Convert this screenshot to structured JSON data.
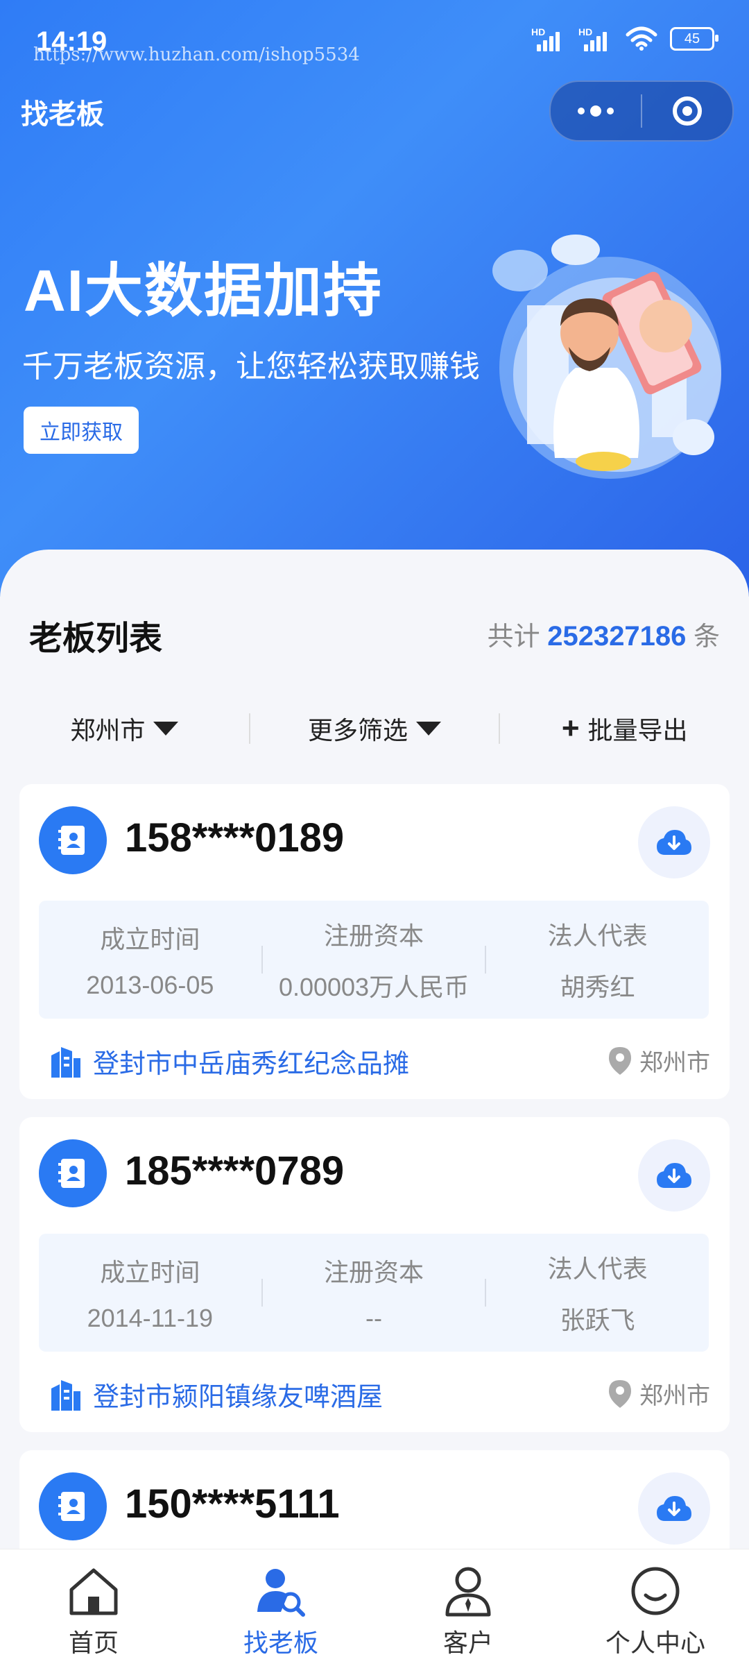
{
  "status": {
    "time": "14:19",
    "watermark": "https://www.huzhan.com/ishop5534",
    "hd1": "HD",
    "hd2": "HD",
    "battery": "45"
  },
  "header": {
    "title": "找老板"
  },
  "banner": {
    "title": "AI大数据加持",
    "subtitle": "千万老板资源，让您轻松获取赚钱",
    "button": "立即获取"
  },
  "list": {
    "title": "老板列表",
    "total_prefix": "共计",
    "total_count": "252327186",
    "total_suffix": "条"
  },
  "filters": {
    "city": "郑州市",
    "more": "更多筛选",
    "export": "批量导出"
  },
  "cards": [
    {
      "phone": "158****0189",
      "founded_label": "成立时间",
      "founded": "2013-06-05",
      "capital_label": "注册资本",
      "capital": "0.00003万人民币",
      "legal_label": "法人代表",
      "legal": "胡秀红",
      "company": "登封市中岳庙秀红纪念品摊",
      "city": "郑州市"
    },
    {
      "phone": "185****0789",
      "founded_label": "成立时间",
      "founded": "2014-11-19",
      "capital_label": "注册资本",
      "capital": "--",
      "legal_label": "法人代表",
      "legal": "张跃飞",
      "company": "登封市颍阳镇缘友啤酒屋",
      "city": "郑州市"
    },
    {
      "phone": "150****5111"
    }
  ],
  "tabbar": {
    "home": "首页",
    "find_boss": "找老板",
    "customers": "客户",
    "profile": "个人中心"
  },
  "colors": {
    "primary": "#2a6be6",
    "hero_start": "#2f7cf6",
    "hero_end": "#2b63e8"
  }
}
